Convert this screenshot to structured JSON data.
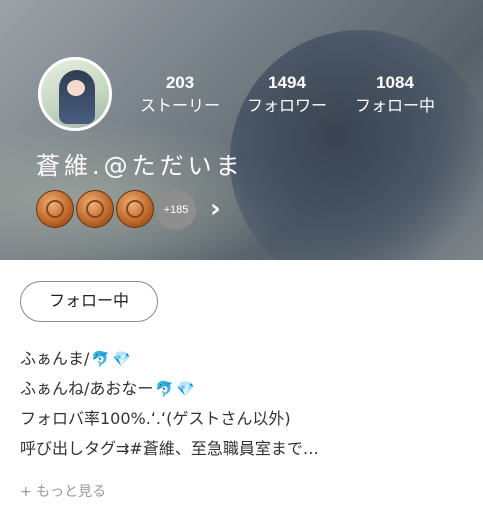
{
  "profile": {
    "name": "蒼維.@ただいま",
    "stats": [
      {
        "value": "203",
        "label": "ストーリー"
      },
      {
        "value": "1494",
        "label": "フォロワー"
      },
      {
        "value": "1084",
        "label": "フォロー中"
      }
    ],
    "badge_extra_count": "+185",
    "badge_count_shown": 3
  },
  "actions": {
    "follow_label": "フォロー中"
  },
  "bio": {
    "lines": [
      "ふぁんま/",
      "ふぁんね/あおなー",
      "フォロバ率100%.ʻ.ʻ(ゲストさん以外)",
      "呼び出しタグ⇉#蒼維、至急職員室まで…"
    ],
    "emoji": {
      "dolphin": "🐬",
      "gem": "💎"
    },
    "more_label": "+ もっと見る"
  },
  "icons": {
    "chevron": "chevron-right-icon"
  },
  "colors": {
    "header_overlay": "#6b7782",
    "badge_bronze": "#c06a2c",
    "more_text": "#9a9a9a",
    "dolphin": "#2a55d0",
    "gem": "#e23ad6"
  }
}
